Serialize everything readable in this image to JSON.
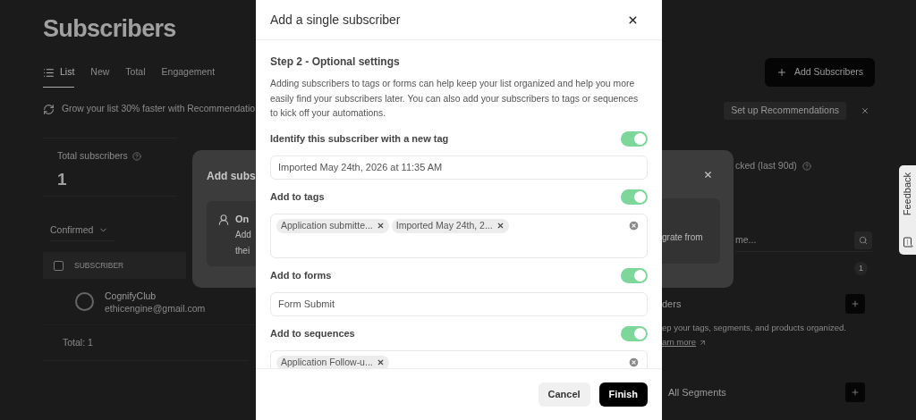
{
  "page": {
    "title": "Subscribers",
    "tabs": [
      {
        "label": "List",
        "selected": true
      },
      {
        "label": "New",
        "selected": false
      },
      {
        "label": "Total",
        "selected": false
      },
      {
        "label": "Engagement",
        "selected": false
      }
    ],
    "add_button": "Add Subscribers",
    "banner": {
      "text": "Grow your list 30% faster with Recommendatio",
      "action": "Set up Recommendations"
    },
    "stats": [
      {
        "label": "Total subscribers",
        "value": "1"
      },
      {
        "label": "cked (last 90d)"
      }
    ],
    "filter": "Confirmed",
    "table": {
      "select_all_checked": false,
      "column": "SUBSCRIBER",
      "rows": [
        {
          "name": "CognifyClub",
          "email": "ethicengine@gmail.com"
        }
      ],
      "footer": "Total: 1"
    },
    "search": {
      "placeholder": "me..."
    },
    "count": "1",
    "folders": {
      "title": "ders",
      "text": "ep your tags, segments, and products organized.",
      "link": "arn more"
    },
    "segments": {
      "title": "All Segments"
    },
    "feedback": "Feedback"
  },
  "behind_dialog": {
    "title": "Add subs",
    "option": {
      "title": "On",
      "lines": [
        "Add",
        "thei"
      ],
      "right_text": "grate from"
    }
  },
  "modal": {
    "title": "Add a single subscriber",
    "step": "Step 2 - Optional settings",
    "description": "Adding subscribers to tags or forms can help keep your list organized and help you more easily find your subscribers later. You can also add your subscribers to tags or sequences to kick off your automations.",
    "sections": [
      {
        "label": "Identify this subscriber with a new tag",
        "on": true,
        "kind": "text",
        "value": "Imported May 24th, 2026 at 11:35 AM"
      },
      {
        "label": "Add to tags",
        "on": true,
        "kind": "tags",
        "tags": [
          "Application submitte...",
          "Imported May 24th, 2..."
        ]
      },
      {
        "label": "Add to forms",
        "on": true,
        "kind": "text",
        "value": "Form Submit"
      },
      {
        "label": "Add to sequences",
        "on": true,
        "kind": "tags",
        "tags": [
          "Application Follow-u..."
        ]
      }
    ],
    "buttons": [
      {
        "label": "Cancel",
        "kind": "secondary"
      },
      {
        "label": "Finish",
        "kind": "primary"
      }
    ]
  }
}
